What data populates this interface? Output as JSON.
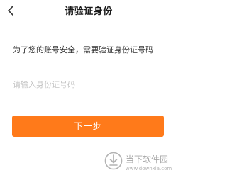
{
  "header": {
    "title": "请验证身份",
    "back_icon": "chevron-left-icon"
  },
  "form": {
    "tip": "为了您的账号安全，需要验证身份证号码",
    "id_input": {
      "placeholder": "请输入身份证号码",
      "value": ""
    },
    "next_button": "下一步"
  },
  "colors": {
    "accent": "#ff7a1a",
    "placeholder": "#c4c4c4"
  },
  "watermark": {
    "name": "当下软件园",
    "url": "www.downxia.com"
  }
}
